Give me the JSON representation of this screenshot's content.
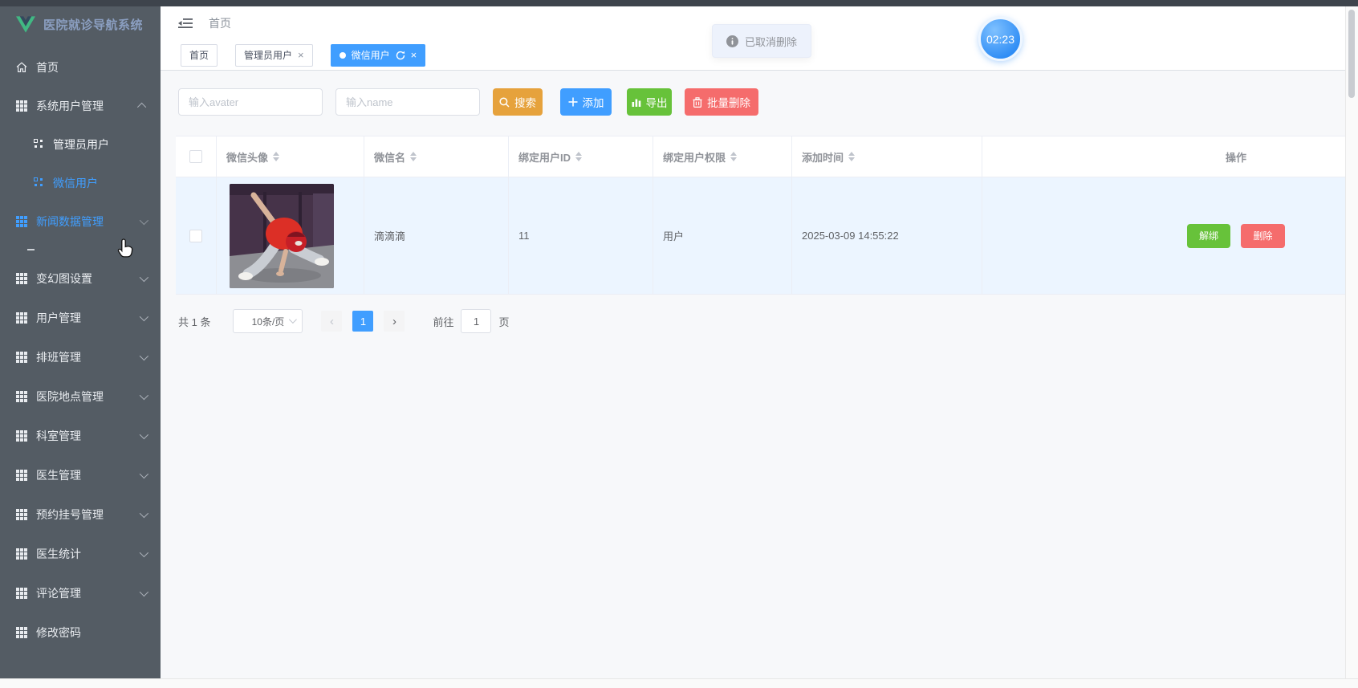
{
  "app": {
    "title": "医院就诊导航系统"
  },
  "colors": {
    "primary": "#409eff",
    "success": "#67c23a",
    "warning": "#e6a23c",
    "danger": "#f56c6c",
    "sidebar_bg": "#545c64",
    "active_row_bg": "#ecf5ff"
  },
  "sidebar": {
    "logo_title": "医院就诊导航系统",
    "items": [
      {
        "label": "首页",
        "icon": "home-icon"
      },
      {
        "label": "系统用户管理",
        "icon": "grid-icon",
        "expanded": true,
        "children": [
          {
            "label": "管理员用户",
            "icon": "subgrid-icon",
            "active": false
          },
          {
            "label": "微信用户",
            "icon": "subgrid-icon",
            "active": true
          }
        ]
      },
      {
        "label": "新闻数据管理",
        "icon": "grid-icon",
        "hovered": true
      },
      {
        "label": "变幻图设置",
        "icon": "grid-icon"
      },
      {
        "label": "用户管理",
        "icon": "grid-icon"
      },
      {
        "label": "排班管理",
        "icon": "grid-icon"
      },
      {
        "label": "医院地点管理",
        "icon": "grid-icon"
      },
      {
        "label": "科室管理",
        "icon": "grid-icon"
      },
      {
        "label": "医生管理",
        "icon": "grid-icon"
      },
      {
        "label": "预约挂号管理",
        "icon": "grid-icon"
      },
      {
        "label": "医生统计",
        "icon": "grid-icon"
      },
      {
        "label": "评论管理",
        "icon": "grid-icon"
      },
      {
        "label": "修改密码",
        "icon": "grid-icon"
      }
    ]
  },
  "topbar": {
    "breadcrumb": "首页"
  },
  "tabs": {
    "items": [
      {
        "label": "首页",
        "active": false,
        "closable": false
      },
      {
        "label": "管理员用户",
        "active": false,
        "closable": true
      },
      {
        "label": "微信用户",
        "active": true,
        "closable": true,
        "refreshable": true
      }
    ]
  },
  "toast": {
    "text": "已取消删除",
    "type": "info"
  },
  "recorder": {
    "time": "02:23"
  },
  "filters": {
    "avatar_placeholder": "输入avater",
    "name_placeholder": "输入name"
  },
  "toolbar": {
    "search": "搜索",
    "add": "添加",
    "export": "导出",
    "batch_delete": "批量删除"
  },
  "table": {
    "columns": [
      "微信头像",
      "微信名",
      "绑定用户ID",
      "绑定用户权限",
      "添加时间",
      "操作"
    ],
    "rows": [
      {
        "avatar": "photo: person in red spider mask dancing, purple wall, gray floor",
        "wechat_name": "滴滴滴",
        "bound_user_id": "11",
        "permission": "用户",
        "added_time": "2025-03-09 14:55:22",
        "unbind": "解绑",
        "delete": "删除",
        "selected": false
      }
    ]
  },
  "pagination": {
    "total": "共 1 条",
    "page_size": "10条/页",
    "prev": "‹",
    "next": "›",
    "current": "1",
    "goto_label": "前往",
    "goto_value": "1",
    "goto_unit": "页"
  },
  "icons": {
    "close": "×"
  }
}
